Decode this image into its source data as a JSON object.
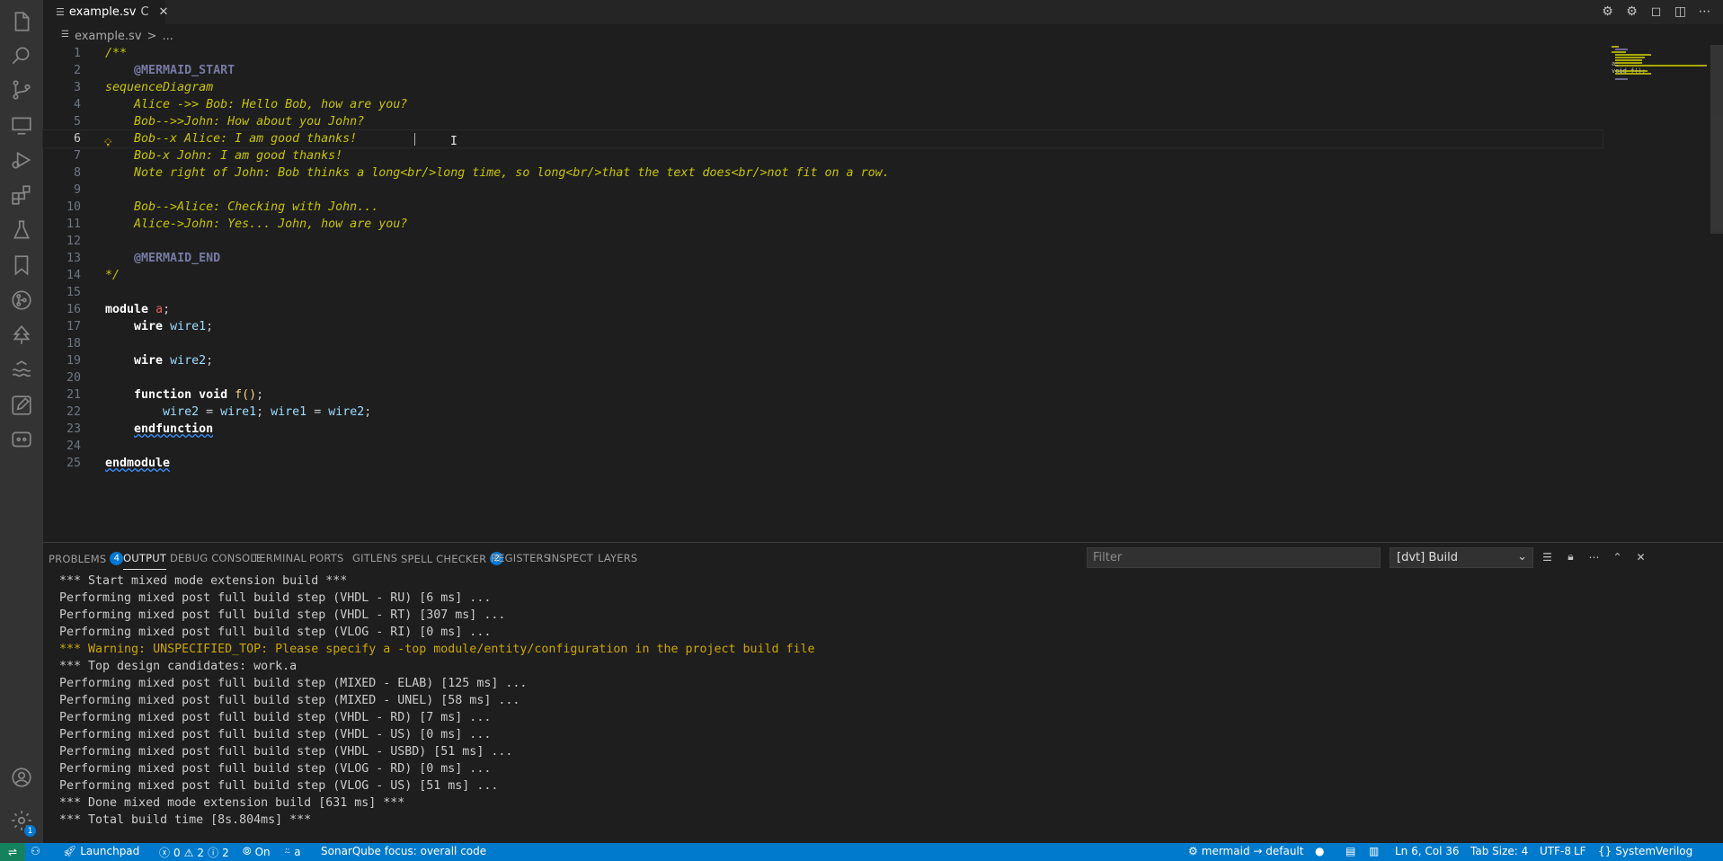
{
  "tab": {
    "title": "example.sv",
    "modified_marker": "C",
    "close": "✕"
  },
  "breadcrumb": {
    "file": "example.sv",
    "sep": ">",
    "tail": "..."
  },
  "editor": {
    "lines": [
      {
        "n": "1",
        "code": "/**"
      },
      {
        "n": "2",
        "code": "    @MERMAID_START"
      },
      {
        "n": "3",
        "code": "sequenceDiagram"
      },
      {
        "n": "4",
        "code": "    Alice ->> Bob: Hello Bob, how are you?"
      },
      {
        "n": "5",
        "code": "    Bob-->>John: How about you John?"
      },
      {
        "n": "6",
        "code": "    Bob--x Alice: I am good thanks!"
      },
      {
        "n": "7",
        "code": "    Bob-x John: I am good thanks!"
      },
      {
        "n": "8",
        "code": "    Note right of John: Bob thinks a long<br/>long time, so long<br/>that the text does<br/>not fit on a row."
      },
      {
        "n": "9",
        "code": ""
      },
      {
        "n": "10",
        "code": "    Bob-->Alice: Checking with John..."
      },
      {
        "n": "11",
        "code": "    Alice->John: Yes... John, how are you?"
      },
      {
        "n": "12",
        "code": ""
      },
      {
        "n": "13",
        "code": "    @MERMAID_END"
      },
      {
        "n": "14",
        "code": "*/"
      },
      {
        "n": "15",
        "code": ""
      },
      {
        "n": "16",
        "code": "module a;"
      },
      {
        "n": "17",
        "code": "    wire wire1;"
      },
      {
        "n": "18",
        "code": ""
      },
      {
        "n": "19",
        "code": "    wire wire2;"
      },
      {
        "n": "20",
        "code": ""
      },
      {
        "n": "21",
        "code": "    function void f();"
      },
      {
        "n": "22",
        "code": "        wire2 = wire1; wire1 = wire2;"
      },
      {
        "n": "23",
        "code": "    endfunction"
      },
      {
        "n": "24",
        "code": ""
      },
      {
        "n": "25",
        "code": "endmodule"
      }
    ],
    "current_line": 6
  },
  "minimap": {
    "line1": "a;",
    "line2": "void f();"
  },
  "panel": {
    "tabs": [
      {
        "label": "PROBLEMS",
        "badge": "4"
      },
      {
        "label": "OUTPUT",
        "badge": ""
      },
      {
        "label": "DEBUG CONSOLE",
        "badge": ""
      },
      {
        "label": "TERMINAL",
        "badge": ""
      },
      {
        "label": "PORTS",
        "badge": ""
      },
      {
        "label": "GITLENS",
        "badge": ""
      },
      {
        "label": "SPELL CHECKER",
        "badge": "2"
      },
      {
        "label": "REGISTERS",
        "badge": ""
      },
      {
        "label": "INSPECT",
        "badge": ""
      },
      {
        "label": "LAYERS",
        "badge": ""
      }
    ],
    "active_tab": "OUTPUT",
    "filter_placeholder": "Filter",
    "channel": "[dvt] Build",
    "output": [
      {
        "text": "*** Start mixed mode extension build ***",
        "warn": false
      },
      {
        "text": "Performing mixed post full build step (VHDL - RU) [6 ms] ...",
        "warn": false
      },
      {
        "text": "Performing mixed post full build step (VHDL - RT) [307 ms] ...",
        "warn": false
      },
      {
        "text": "Performing mixed post full build step (VLOG - RI) [0 ms] ...",
        "warn": false
      },
      {
        "text": "*** Warning: UNSPECIFIED_TOP: Please specify a -top module/entity/configuration in the project build file",
        "warn": true
      },
      {
        "text": "*** Top design candidates: work.a",
        "warn": false
      },
      {
        "text": "Performing mixed post full build step (MIXED - ELAB) [125 ms] ...",
        "warn": false
      },
      {
        "text": "Performing mixed post full build step (MIXED - UNEL) [58 ms] ...",
        "warn": false
      },
      {
        "text": "Performing mixed post full build step (VHDL - RD) [7 ms] ...",
        "warn": false
      },
      {
        "text": "Performing mixed post full build step (VHDL - US) [0 ms] ...",
        "warn": false
      },
      {
        "text": "Performing mixed post full build step (VHDL - USBD) [51 ms] ...",
        "warn": false
      },
      {
        "text": "Performing mixed post full build step (VLOG - RD) [0 ms] ...",
        "warn": false
      },
      {
        "text": "Performing mixed post full build step (VLOG - US) [51 ms] ...",
        "warn": false
      },
      {
        "text": "*** Done mixed mode extension build [631 ms] ***",
        "warn": false
      },
      {
        "text": "*** Total build time [8s.804ms] ***",
        "warn": false
      }
    ]
  },
  "statusbar": {
    "launchpad": "Launchpad",
    "errors": "0",
    "warnings": "2",
    "infos": "2",
    "sonar_on": "On",
    "branch": "a",
    "sonar_focus": "SonarQube focus: overall code",
    "mermaid": "mermaid → default",
    "position": "Ln 6, Col 36",
    "tab_size": "Tab Size: 4",
    "encoding": "UTF-8",
    "eol": "LF",
    "language": "SystemVerilog"
  },
  "activity_badge": "1",
  "colors": {
    "accent": "#007acc",
    "warning": "#cca700",
    "comment": "#c5c500",
    "badge": "#0078d4"
  }
}
